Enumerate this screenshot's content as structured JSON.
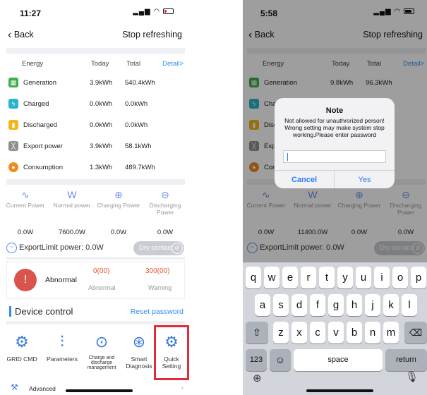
{
  "phone1": {
    "time": "11:27",
    "battery_color": "#e0303a",
    "nav": {
      "back": "Back",
      "stop": "Stop refreshing"
    },
    "energy": {
      "headers": {
        "energy": "Energy",
        "today": "Today",
        "total": "Total",
        "detail": "Detail>"
      },
      "rows": [
        {
          "name": "Generation",
          "today": "3.9kWh",
          "total": "540.4kWh",
          "icon": "solar-panel-icon",
          "color": "#3fae4b"
        },
        {
          "name": "Charged",
          "today": "0.0kWh",
          "total": "0.0kWh",
          "icon": "battery-charging-icon",
          "color": "#2bb3c9"
        },
        {
          "name": "Discharged",
          "today": "0.0kWh",
          "total": "0.0kWh",
          "icon": "battery-discharge-icon",
          "color": "#f2b51b"
        },
        {
          "name": "Export power",
          "today": "3.9kWh",
          "total": "58.1kWh",
          "icon": "power-tower-icon",
          "color": "#8e8e8e"
        },
        {
          "name": "Consumption",
          "today": "1.3kWh",
          "total": "489.7kWh",
          "icon": "consumption-icon",
          "color": "#f08a1c"
        }
      ]
    },
    "power": [
      {
        "label": "Current Power",
        "value": "0.0W",
        "icon": "current-power-icon"
      },
      {
        "label": "Normal power",
        "value": "7600.0W",
        "icon": "normal-power-icon"
      },
      {
        "label": "Charging Power",
        "value": "0.0W",
        "icon": "charging-power-icon"
      },
      {
        "label": "Discharging Power",
        "value": "0.0W",
        "icon": "discharging-power-icon"
      }
    ],
    "export_limit": "ExportLimit power: 0.0W",
    "dry_contact": "Dry contact",
    "abnormal": {
      "label": "Abnormal",
      "abnormal_value": "0(00)",
      "abnormal_label": "Abnormal",
      "warning_value": "300(00)",
      "warning_label": "Warning"
    },
    "device_control": {
      "title": "Device control",
      "reset": "Reset password"
    },
    "tools": [
      {
        "label": "GRID CMD",
        "icon": "grid-cmd-icon"
      },
      {
        "label": "Parameters",
        "icon": "parameters-icon"
      },
      {
        "label": "Charge and discharge management",
        "icon": "charge-management-icon"
      },
      {
        "label": "Smart Diagnosis",
        "icon": "diagnosis-icon"
      },
      {
        "label": "Quick Setting",
        "icon": "quick-setting-icon"
      }
    ],
    "advanced": "Advanced"
  },
  "phone2": {
    "time": "5:58",
    "battery_color": "#111111",
    "nav": {
      "back": "Back",
      "stop": "Stop refreshing"
    },
    "energy": {
      "headers": {
        "energy": "Energy",
        "today": "Today",
        "total": "Total",
        "detail": "Detail>"
      },
      "rows": [
        {
          "name": "Generation",
          "today": "9.8kWh",
          "total": "96.3kWh"
        },
        {
          "name": "Cha",
          "today": "",
          "total": ""
        },
        {
          "name": "Disc",
          "today": "",
          "total": ""
        },
        {
          "name": "Exp",
          "today": "",
          "total": ""
        },
        {
          "name": "Cor",
          "today": "",
          "total": ""
        }
      ]
    },
    "power": [
      {
        "label": "Current Power",
        "value": "0.0W"
      },
      {
        "label": "Normal power",
        "value": "11400.0W"
      },
      {
        "label": "Charging Power",
        "value": "0.0W"
      },
      {
        "label": "Discharging Power",
        "value": "0.0W"
      }
    ],
    "export_limit": "ExportLimit power: 0.0W",
    "dry_contact": "Dry contact",
    "dialog": {
      "title": "Note",
      "message": "Not allowed for unauthrorized person! Wrong setting may make system stop working.Please enter password",
      "cancel": "Cancel",
      "yes": "Yes"
    },
    "keyboard": {
      "row1": [
        "q",
        "w",
        "e",
        "r",
        "t",
        "y",
        "u",
        "i",
        "o",
        "p"
      ],
      "row2": [
        "a",
        "s",
        "d",
        "f",
        "g",
        "h",
        "j",
        "k",
        "l"
      ],
      "row3": [
        "z",
        "x",
        "c",
        "v",
        "b",
        "n",
        "m"
      ],
      "shift": "⇧",
      "backspace": "⌫",
      "numbers": "123",
      "emoji": "☺",
      "space": "space",
      "return": "return"
    }
  }
}
